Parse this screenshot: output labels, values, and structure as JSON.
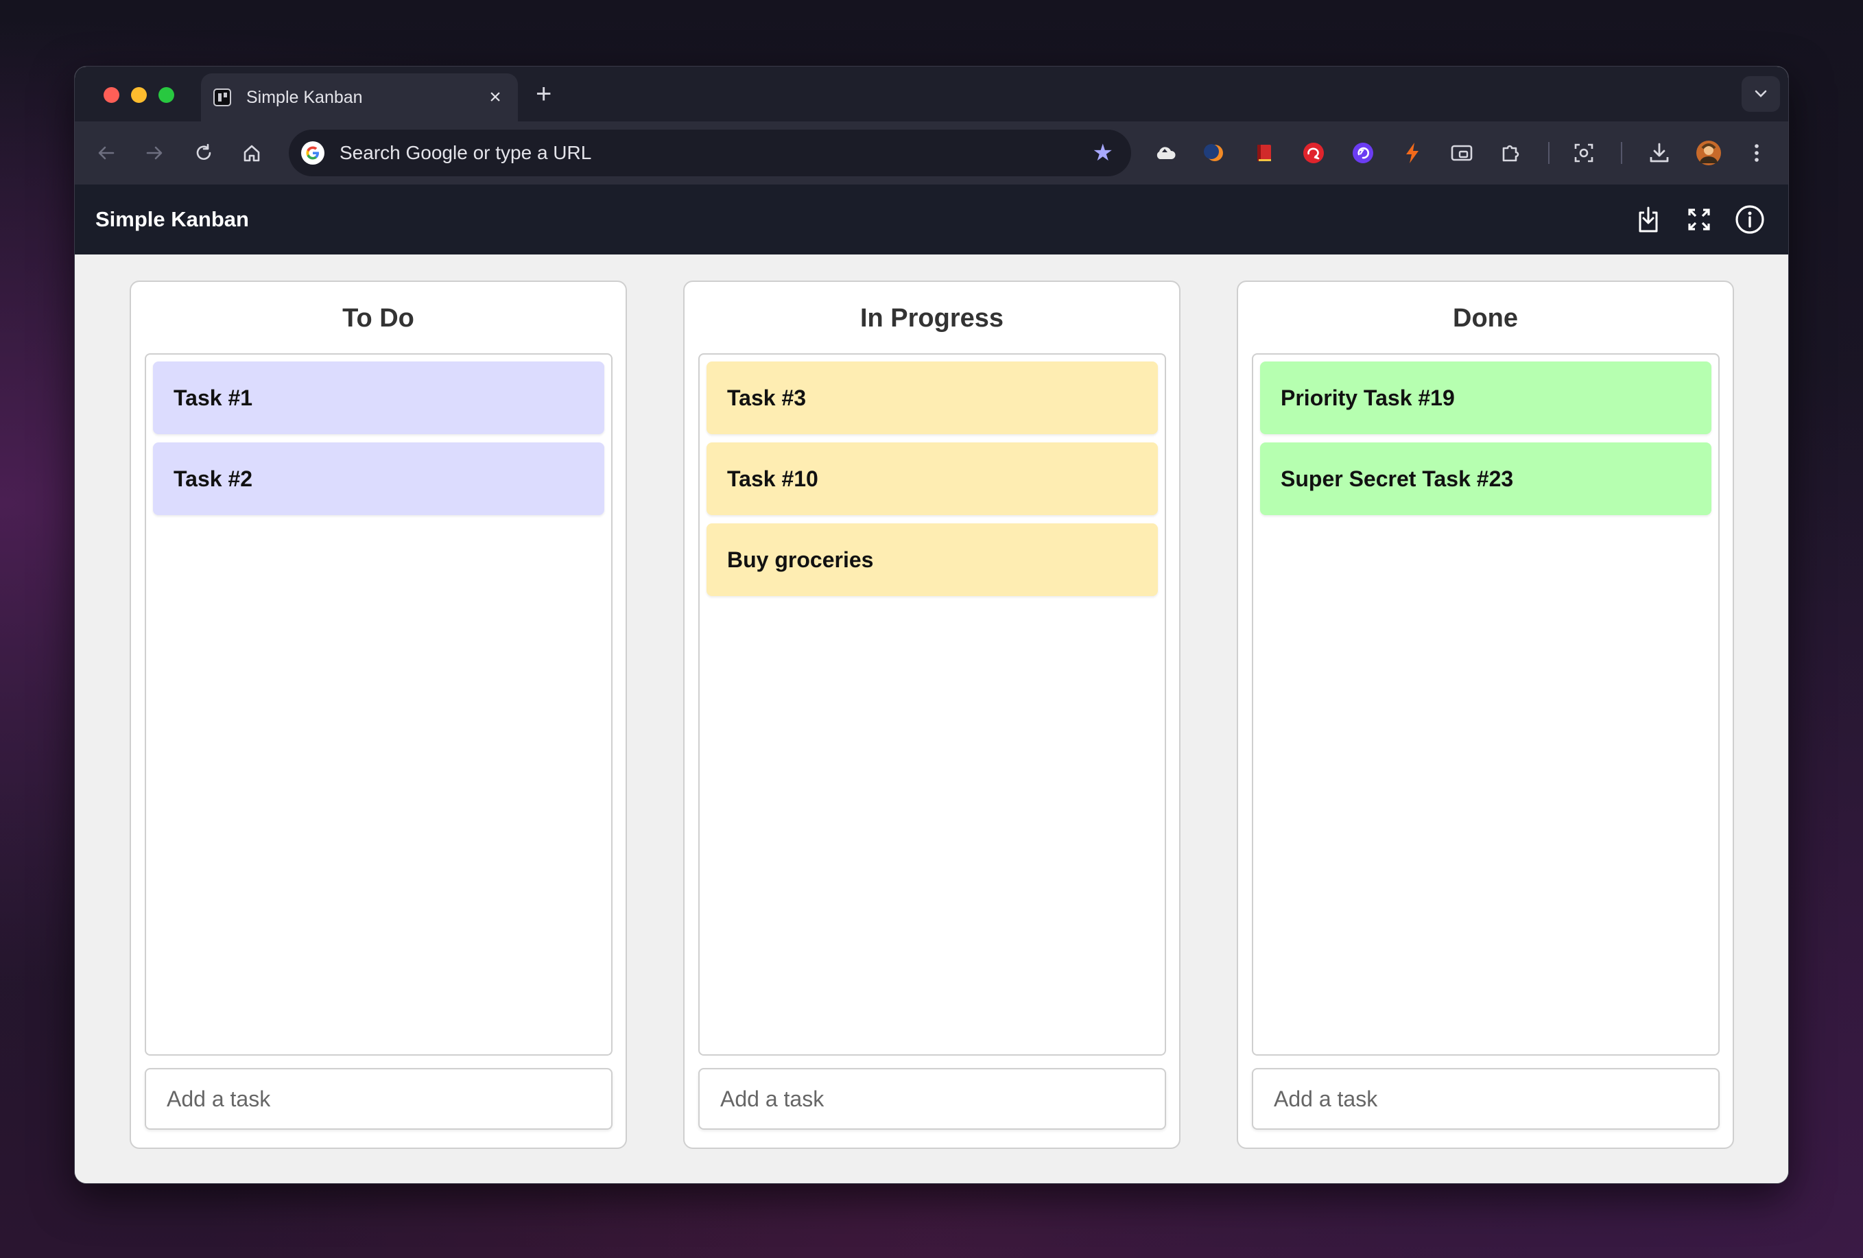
{
  "browser": {
    "tab": {
      "title": "Simple Kanban",
      "favicon": "kanban-favicon"
    },
    "new_tab_label": "+",
    "address_bar": {
      "placeholder": "Search Google or type a URL"
    },
    "extensions": [
      "cloud-icon",
      "moon-icon",
      "book-icon",
      "chat-icon",
      "circle-arrow-icon",
      "bolt-icon",
      "cast-icon",
      "puzzle-icon",
      "screenshot-icon",
      "download-icon",
      "avatar"
    ]
  },
  "app": {
    "title": "Simple Kanban",
    "header_icons": [
      "download-icon",
      "fullscreen-icon",
      "info-icon"
    ]
  },
  "columns": [
    {
      "title": "To Do",
      "color": "#dcdcfe",
      "tasks": [
        "Task #1",
        "Task #2"
      ],
      "input_placeholder": "Add a task"
    },
    {
      "title": "In Progress",
      "color": "#feedb2",
      "tasks": [
        "Task #3",
        "Task #10",
        "Buy groceries"
      ],
      "input_placeholder": "Add a task"
    },
    {
      "title": "Done",
      "color": "#b6ffb0",
      "tasks": [
        "Priority Task #19",
        "Super Secret Task #23"
      ],
      "input_placeholder": "Add a task"
    }
  ]
}
